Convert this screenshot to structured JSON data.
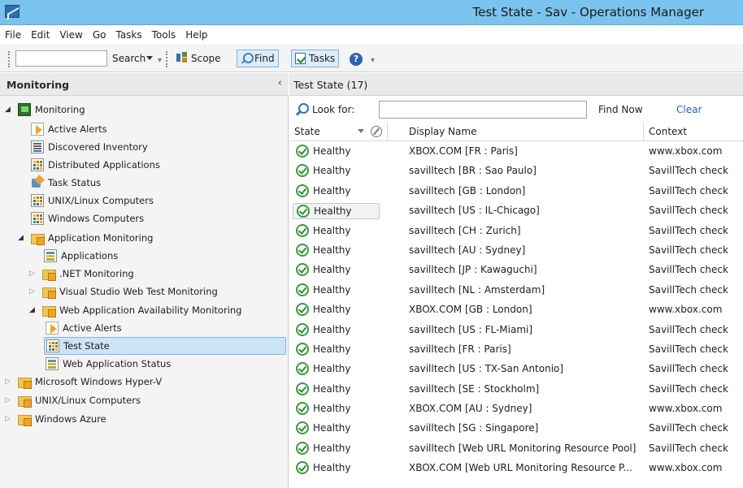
{
  "window": {
    "title": "Test State - Sav - Operations Manager"
  },
  "menu": [
    "File",
    "Edit",
    "View",
    "Go",
    "Tasks",
    "Tools",
    "Help"
  ],
  "toolbar": {
    "search_value": "",
    "search_label": "Search",
    "scope_label": "Scope",
    "find_label": "Find",
    "tasks_label": "Tasks"
  },
  "nav": {
    "header": "Monitoring",
    "items": [
      {
        "label": "Monitoring",
        "icon": "monitoring-icon"
      },
      {
        "label": "Active Alerts",
        "icon": "alert-view-icon"
      },
      {
        "label": "Discovered Inventory",
        "icon": "inventory-icon"
      },
      {
        "label": "Distributed Applications",
        "icon": "grid-view-icon"
      },
      {
        "label": "Task Status",
        "icon": "task-icon"
      },
      {
        "label": "UNIX/Linux Computers",
        "icon": "grid-view-icon"
      },
      {
        "label": "Windows Computers",
        "icon": "grid-view-icon"
      },
      {
        "label": "Application Monitoring",
        "icon": "folder-icon"
      },
      {
        "label": "Applications",
        "icon": "app-view-icon"
      },
      {
        "label": ".NET Monitoring",
        "icon": "folder-icon"
      },
      {
        "label": "Visual Studio Web Test Monitoring",
        "icon": "folder-icon"
      },
      {
        "label": "Web Application Availability Monitoring",
        "icon": "folder-icon"
      },
      {
        "label": "Active Alerts",
        "icon": "alert-view-icon"
      },
      {
        "label": "Test State",
        "icon": "grid-view-icon"
      },
      {
        "label": "Web Application Status",
        "icon": "app-view-icon"
      },
      {
        "label": "Microsoft Windows Hyper-V",
        "icon": "folder-icon"
      },
      {
        "label": "UNIX/Linux Computers",
        "icon": "folder-icon"
      },
      {
        "label": "Windows Azure",
        "icon": "folder-icon"
      }
    ]
  },
  "results": {
    "header": "Test State (17)",
    "look_for_label": "Look for:",
    "look_for_value": "",
    "find_now_label": "Find Now",
    "clear_label": "Clear",
    "columns": {
      "state": "State",
      "display_name": "Display Name",
      "context": "Context"
    },
    "rows": [
      {
        "state": "Healthy",
        "name": "XBOX.COM [FR : Paris]",
        "context": "www.xbox.com"
      },
      {
        "state": "Healthy",
        "name": "savilltech [BR : Sao Paulo]",
        "context": "SavillTech check"
      },
      {
        "state": "Healthy",
        "name": "savilltech [GB : London]",
        "context": "SavillTech check"
      },
      {
        "state": "Healthy",
        "name": "savilltech [US : IL-Chicago]",
        "context": "SavillTech check"
      },
      {
        "state": "Healthy",
        "name": "savilltech [CH : Zurich]",
        "context": "SavillTech check"
      },
      {
        "state": "Healthy",
        "name": "savilltech [AU : Sydney]",
        "context": "SavillTech check"
      },
      {
        "state": "Healthy",
        "name": "savilltech [JP : Kawaguchi]",
        "context": "SavillTech check"
      },
      {
        "state": "Healthy",
        "name": "savilltech [NL : Amsterdam]",
        "context": "SavillTech check"
      },
      {
        "state": "Healthy",
        "name": "XBOX.COM [GB : London]",
        "context": "www.xbox.com"
      },
      {
        "state": "Healthy",
        "name": "savilltech [US : FL-Miami]",
        "context": "SavillTech check"
      },
      {
        "state": "Healthy",
        "name": "savilltech [FR : Paris]",
        "context": "SavillTech check"
      },
      {
        "state": "Healthy",
        "name": "savilltech [US : TX-San Antonio]",
        "context": "SavillTech check"
      },
      {
        "state": "Healthy",
        "name": "savilltech [SE : Stockholm]",
        "context": "SavillTech check"
      },
      {
        "state": "Healthy",
        "name": "XBOX.COM [AU : Sydney]",
        "context": "www.xbox.com"
      },
      {
        "state": "Healthy",
        "name": "savilltech [SG : Singapore]",
        "context": "SavillTech check"
      },
      {
        "state": "Healthy",
        "name": "savilltech [Web URL Monitoring Resource Pool]",
        "context": "SavillTech check"
      },
      {
        "state": "Healthy",
        "name": "XBOX.COM [Web URL Monitoring Resource P...",
        "context": "www.xbox.com"
      }
    ]
  }
}
